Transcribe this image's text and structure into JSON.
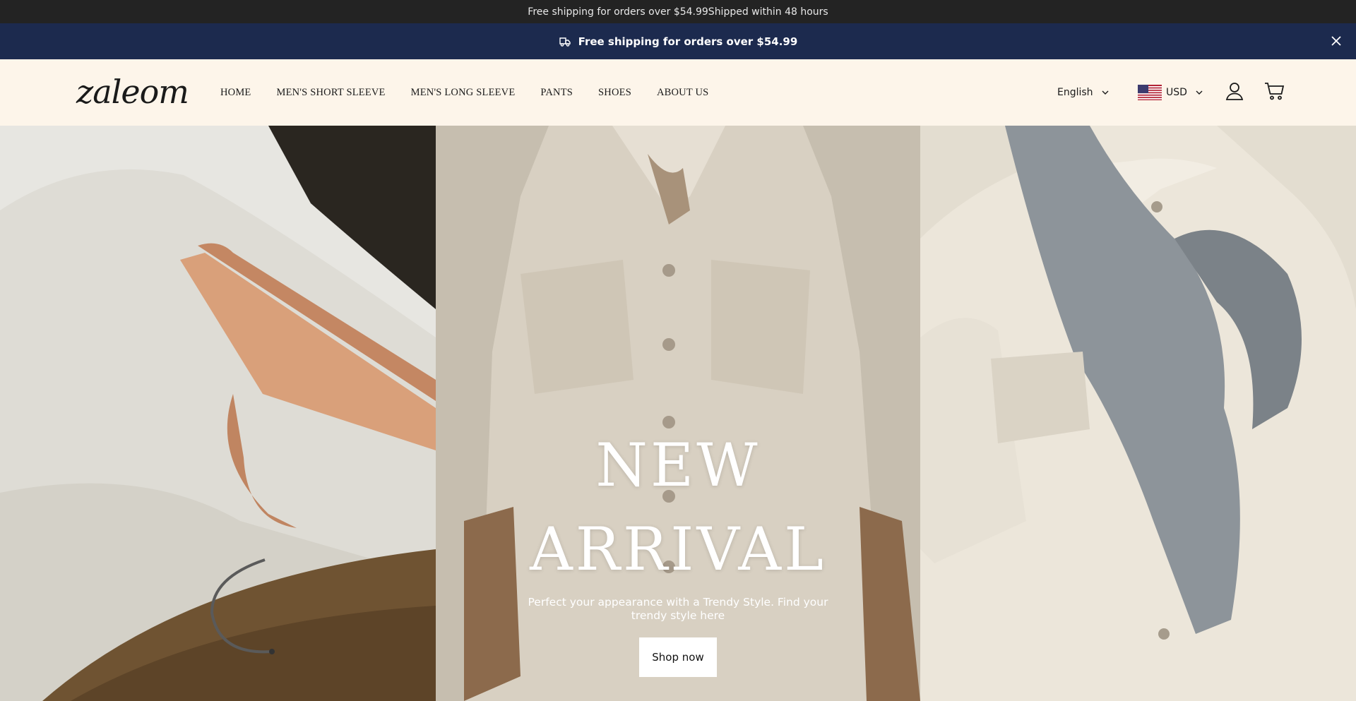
{
  "topbar": {
    "text": "Free shipping for orders over $54.99Shipped within 48 hours"
  },
  "announcement": {
    "icon": "truck-icon",
    "text": "Free shipping for orders over $54.99",
    "close_icon": "close-icon"
  },
  "header": {
    "logo": "zaleom",
    "nav": [
      "HOME",
      "MEN'S SHORT SLEEVE",
      "MEN'S LONG SLEEVE",
      "PANTS",
      "SHOES",
      "ABOUT US"
    ],
    "language": "English",
    "currency": "USD",
    "flag_icon": "us-flag-icon",
    "account_icon": "user-icon",
    "cart_icon": "cart-icon"
  },
  "hero": {
    "title_line1": "NEW",
    "title_line2": "ARRIVAL",
    "subtitle": "Perfect your appearance with a Trendy Style. Find your trendy style here",
    "button": "Shop now"
  },
  "colors": {
    "topbar_bg": "#232323",
    "announce_bg": "#1c2a4e",
    "header_bg": "#fdf5ea"
  }
}
